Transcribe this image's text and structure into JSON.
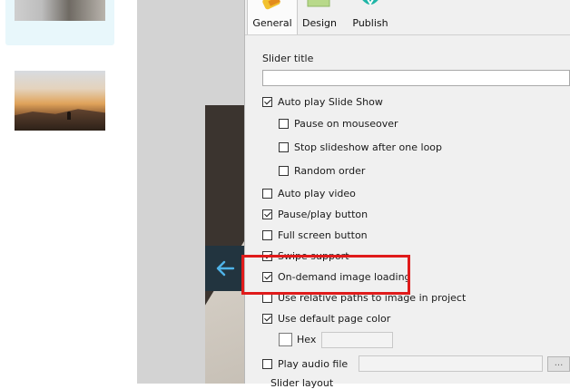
{
  "tabs": [
    {
      "label": "General",
      "icon": "general-icon",
      "color": "#f2c12e"
    },
    {
      "label": "Design",
      "icon": "design-icon",
      "color": "#b8d98a"
    },
    {
      "label": "Publish",
      "icon": "publish-icon",
      "color": "#1fb5a6"
    }
  ],
  "slider_title": {
    "label": "Slider title",
    "value": ""
  },
  "options": [
    {
      "label": "Auto play Slide Show",
      "checked": true
    },
    {
      "label": "Pause on mouseover",
      "checked": false
    },
    {
      "label": "Stop slideshow after one loop",
      "checked": false
    },
    {
      "label": "Random order",
      "checked": false
    },
    {
      "label": "Auto play video",
      "checked": false
    },
    {
      "label": "Pause/play button",
      "checked": true
    },
    {
      "label": "Full screen button",
      "checked": false
    },
    {
      "label": "Swipe support",
      "checked": true
    },
    {
      "label": "On-demand image loading",
      "checked": true
    },
    {
      "label": "Use relative paths to image in project",
      "checked": false
    },
    {
      "label": "Use default page color",
      "checked": true
    }
  ],
  "hex": {
    "label": "Hex",
    "value": "",
    "checked": false
  },
  "play_audio": {
    "label": "Play audio file",
    "checked": false,
    "value": "",
    "browse_label": "..."
  },
  "slider_layout": {
    "label": "Slider layout"
  },
  "colors": {
    "highlight": "#e01b1b",
    "nav_arrow": "#4fb3e8"
  }
}
